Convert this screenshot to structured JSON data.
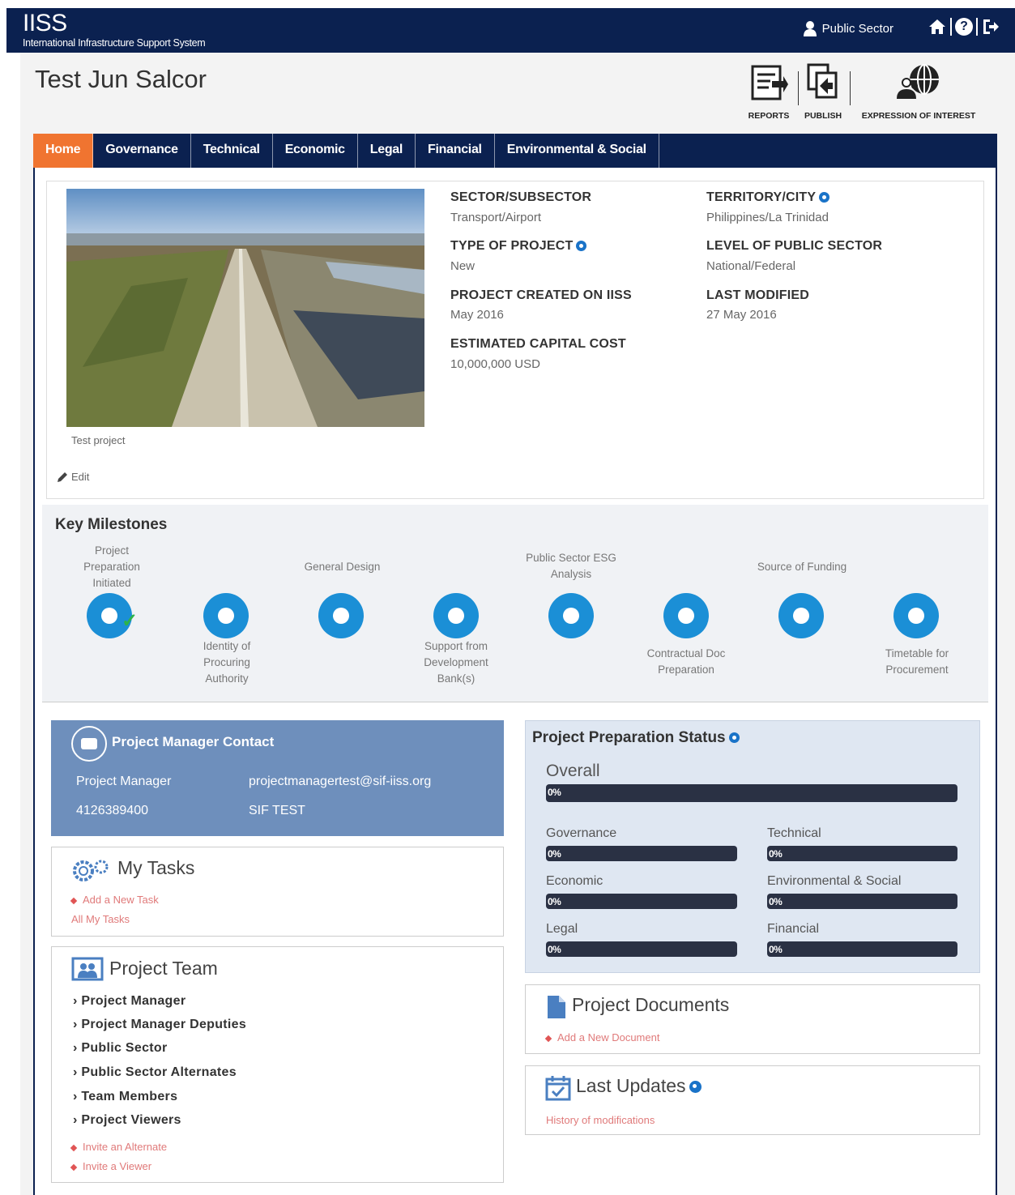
{
  "header": {
    "logo": "IISS",
    "logo_subtitle": "International Infrastructure Support System",
    "user_role": "Public Sector"
  },
  "page": {
    "title": "Test Jun Salcor"
  },
  "tools": {
    "reports": "REPORTS",
    "publish": "PUBLISH",
    "eoi": "EXPRESSION OF INTEREST"
  },
  "nav": [
    "Home",
    "Governance",
    "Technical",
    "Economic",
    "Legal",
    "Financial",
    "Environmental & Social"
  ],
  "project": {
    "caption": "Test project",
    "edit": "Edit",
    "fields": {
      "sector_label": "SECTOR/SUBSECTOR",
      "sector_value": "Transport/Airport",
      "territory_label": "TERRITORY/CITY",
      "territory_value": "Philippines/La Trinidad",
      "type_label": "TYPE OF PROJECT",
      "type_value": "New",
      "level_label": "LEVEL OF PUBLIC SECTOR",
      "level_value": "National/Federal",
      "created_label": "PROJECT CREATED ON IISS",
      "created_value": "May 2016",
      "modified_label": "LAST MODIFIED",
      "modified_value": "27 May 2016",
      "cost_label": "ESTIMATED CAPITAL COST",
      "cost_value": "10,000,000 USD"
    }
  },
  "milestones": {
    "title": "Key Milestones",
    "items": [
      "Project Preparation Initiated",
      "Identity of Procuring Authority",
      "General Design",
      "Support from Development Bank(s)",
      "Public Sector ESG Analysis",
      "Contractual Doc Preparation",
      "Source of Funding",
      "Timetable for Procurement"
    ]
  },
  "contact": {
    "title": "Project Manager Contact",
    "role": "Project Manager",
    "email": "projectmanagertest@sif-iiss.org",
    "phone": "4126389400",
    "org": "SIF TEST"
  },
  "tasks": {
    "title": "My Tasks",
    "add": "Add a New Task",
    "all": "All My Tasks"
  },
  "team": {
    "title": "Project Team",
    "items": [
      "Project Manager",
      "Project Manager Deputies",
      "Public Sector",
      "Public Sector Alternates",
      "Team Members",
      "Project Viewers"
    ],
    "invite_alt": "Invite an Alternate",
    "invite_viewer": "Invite a Viewer"
  },
  "status": {
    "title": "Project Preparation Status",
    "overall_label": "Overall",
    "overall_pct": "0%",
    "bars": [
      {
        "label": "Governance",
        "pct": "0%"
      },
      {
        "label": "Technical",
        "pct": "0%"
      },
      {
        "label": "Economic",
        "pct": "0%"
      },
      {
        "label": "Environmental & Social",
        "pct": "0%"
      },
      {
        "label": "Legal",
        "pct": "0%"
      },
      {
        "label": "Financial",
        "pct": "0%"
      }
    ]
  },
  "documents": {
    "title": "Project Documents",
    "add": "Add a New Document"
  },
  "updates": {
    "title": "Last Updates",
    "history": "History of modifications"
  },
  "colors": {
    "navy": "#0b2150",
    "accent": "#f07430",
    "milestone": "#1b8fd6",
    "contact_bg": "#6e8fbc"
  }
}
